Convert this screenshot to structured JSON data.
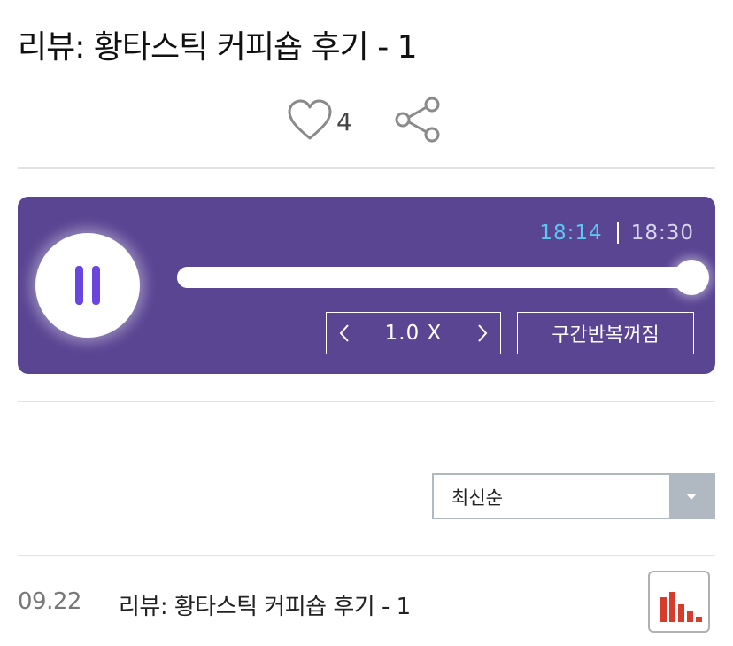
{
  "page": {
    "title": "리뷰: 황타스틱 커피숍 후기 - 1"
  },
  "actions": {
    "like_icon": "heart-outline-icon",
    "like_count": "4",
    "share_icon": "share-icon"
  },
  "player": {
    "state": "playing",
    "pause_icon": "pause-icon",
    "current_time": "18:14",
    "total_time": "18:30",
    "progress_fraction": 0.985,
    "speed_prev_icon": "chevron-left-icon",
    "speed_value": "1.0 X",
    "speed_next_icon": "chevron-right-icon",
    "repeat_label": "구간반복꺼짐",
    "colors": {
      "background": "#5a4593",
      "current_time": "#5bc7f3",
      "pause_icon": "#6a46e0"
    }
  },
  "sort": {
    "selected": "최신순",
    "caret_icon": "caret-down-icon"
  },
  "episodes": [
    {
      "date": "09.22",
      "title": "리뷰: 황타스틱 커피숍 후기 - 1",
      "status_icon": "now-playing-bars-icon"
    }
  ]
}
